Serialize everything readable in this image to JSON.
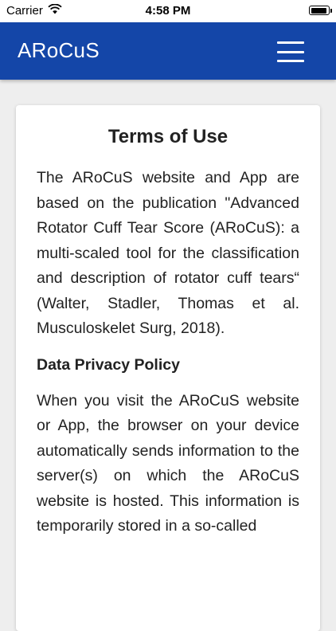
{
  "status_bar": {
    "carrier": "Carrier",
    "time": "4:58 PM"
  },
  "header": {
    "brand": "ARoCuS",
    "menu_icon": "hamburger-menu-icon",
    "background_color": "#1446a8"
  },
  "content": {
    "title": "Terms of Use",
    "intro": "The ARoCuS website and App are based on the publication \"Advanced Rotator Cuff Tear Score (ARoCuS): a multi-scaled tool for the classification and description of rotator cuff tears“ (Walter, Stadler, Thomas et al. Musculoskelet Surg, 2018).",
    "privacy_heading": "Data Privacy Policy",
    "privacy_text": "When you visit the ARoCuS website or App, the browser on your device automatically sends information to the server(s) on which the ARoCuS website is hosted. This information is temporarily stored in a so-called"
  }
}
